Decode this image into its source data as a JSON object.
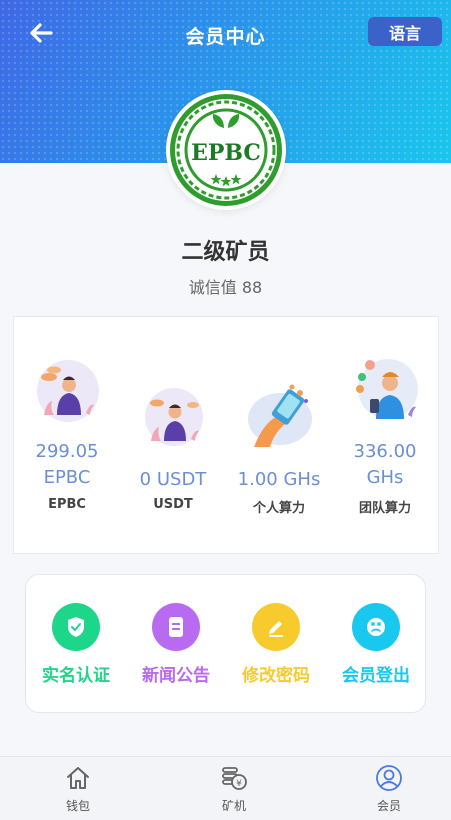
{
  "header": {
    "title": "会员中心",
    "language_button": "语言",
    "back_icon": "arrow-left-icon"
  },
  "profile": {
    "logo_text": "EPBC",
    "level": "二级矿员",
    "credit_label": "诚信值 88"
  },
  "stats": [
    {
      "value_line1": "299.05",
      "value_line2": "EPBC",
      "label": "EPBC",
      "icon": "man-with-coins-illustration"
    },
    {
      "value_line1": "0 USDT",
      "value_line2": "",
      "label": "USDT",
      "icon": "man-with-coins-illustration"
    },
    {
      "value_line1": "1.00 GHs",
      "value_line2": "",
      "label": "个人算力",
      "icon": "hand-with-phone-illustration"
    },
    {
      "value_line1": "336.00",
      "value_line2": "GHs",
      "label": "团队算力",
      "icon": "man-with-phone-illustration"
    }
  ],
  "actions": [
    {
      "label": "实名认证",
      "color": "#1dd68a",
      "icon": "shield-check-icon"
    },
    {
      "label": "新闻公告",
      "color": "#b86af0",
      "icon": "document-icon"
    },
    {
      "label": "修改密码",
      "color": "#f7cb2e",
      "icon": "edit-icon"
    },
    {
      "label": "会员登出",
      "color": "#19c8ee",
      "icon": "logout-face-icon"
    }
  ],
  "tabbar": [
    {
      "label": "钱包",
      "icon": "home-icon"
    },
    {
      "label": "矿机",
      "icon": "coins-icon"
    },
    {
      "label": "会员",
      "icon": "user-icon",
      "active": true
    }
  ],
  "colors": {
    "stat_value": "#6b8fd6",
    "active_tab": "#4a7be0",
    "header_start": "#3f67e6",
    "header_end": "#19c6ec"
  }
}
